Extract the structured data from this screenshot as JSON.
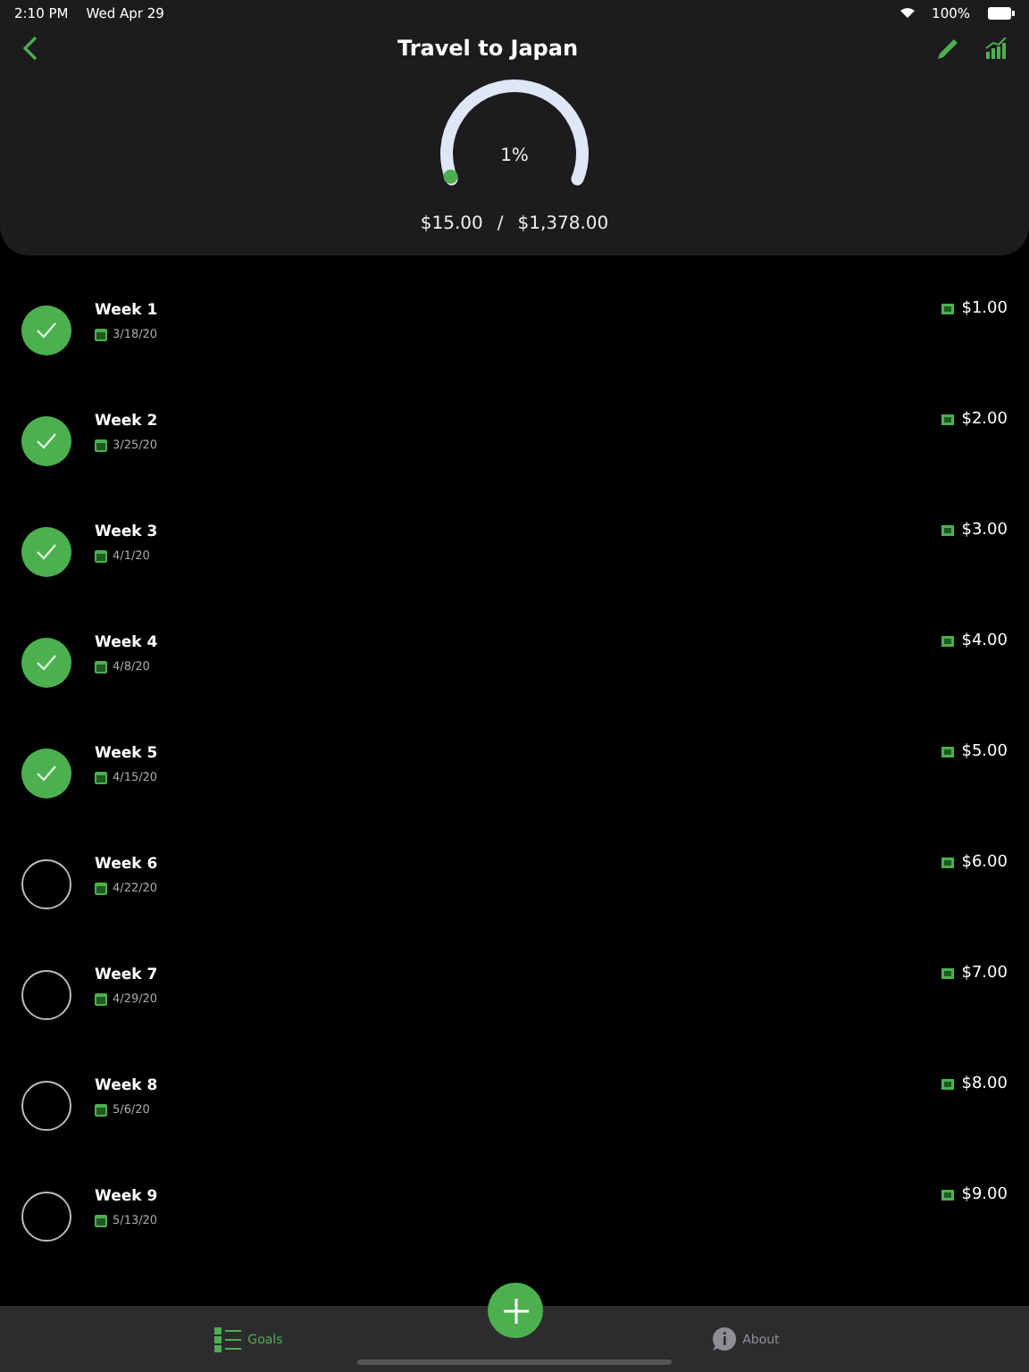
{
  "status_bar": {
    "time": "2:10 PM",
    "date": "Wed Apr 29",
    "battery": "100%"
  },
  "nav": {
    "title": "Travel to Japan"
  },
  "progress": {
    "percent": "1%",
    "level": 0.01,
    "saved": "$15.00",
    "separator": "/",
    "goal": "$1,378.00"
  },
  "deposits": [
    {
      "title": "Week 1",
      "date": "3/18/20",
      "amount": "$1.00",
      "checked": true
    },
    {
      "title": "Week 2",
      "date": "3/25/20",
      "amount": "$2.00",
      "checked": true
    },
    {
      "title": "Week 3",
      "date": "4/1/20",
      "amount": "$3.00",
      "checked": true
    },
    {
      "title": "Week 4",
      "date": "4/8/20",
      "amount": "$4.00",
      "checked": true
    },
    {
      "title": "Week 5",
      "date": "4/15/20",
      "amount": "$5.00",
      "checked": true
    },
    {
      "title": "Week 6",
      "date": "4/22/20",
      "amount": "$6.00",
      "checked": false
    },
    {
      "title": "Week 7",
      "date": "4/29/20",
      "amount": "$7.00",
      "checked": false
    },
    {
      "title": "Week 8",
      "date": "5/6/20",
      "amount": "$8.00",
      "checked": false
    },
    {
      "title": "Week 9",
      "date": "5/13/20",
      "amount": "$9.00",
      "checked": false
    }
  ],
  "tab_bar": {
    "tabs": [
      {
        "label": "Goals",
        "selected": true
      },
      {
        "label": "About",
        "selected": false
      }
    ]
  }
}
